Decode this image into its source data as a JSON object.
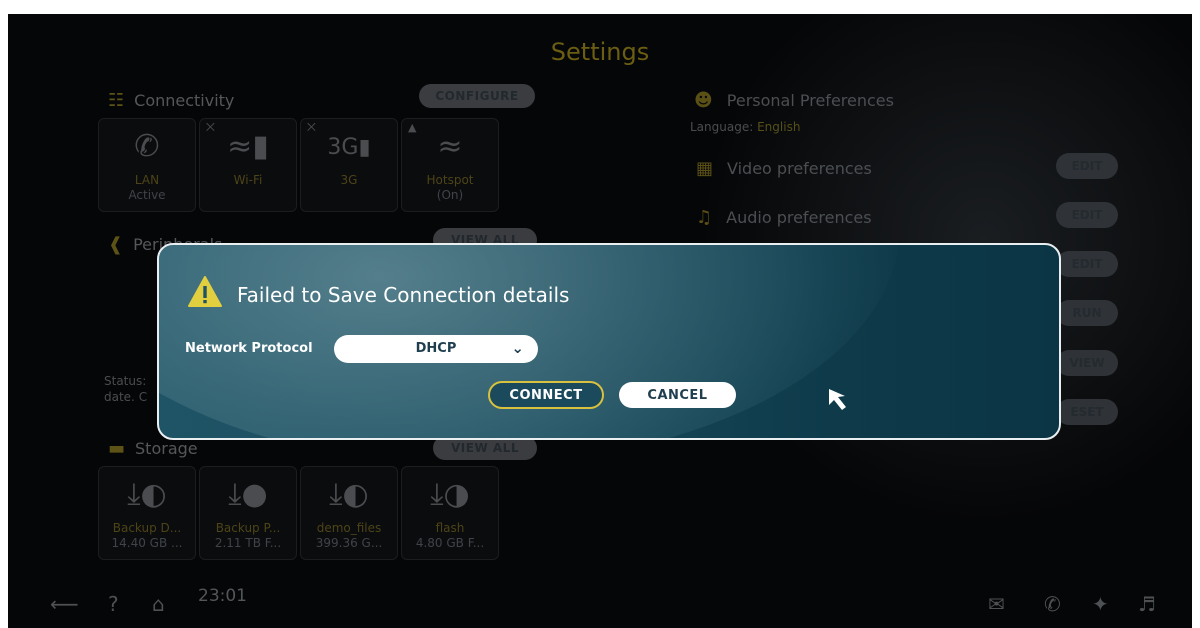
{
  "page": {
    "title": "Settings"
  },
  "connectivity": {
    "heading": "Connectivity",
    "configure_label": "CONFIGURE",
    "tiles": [
      {
        "label": "LAN",
        "sub": "Active",
        "icon": "phone-icon"
      },
      {
        "label": "Wi-Fi",
        "sub": "",
        "icon": "wifi-signal-icon"
      },
      {
        "label": "3G",
        "sub": "",
        "icon": "3g-signal-icon",
        "badge": "3G"
      },
      {
        "label": "Hotspot",
        "sub": "(On)",
        "icon": "hotspot-icon"
      }
    ]
  },
  "peripherals": {
    "heading": "Peripherals",
    "view_all_label": "VIEW ALL"
  },
  "status": {
    "line1": "Status:",
    "line2": "date. C"
  },
  "storage": {
    "heading": "Storage",
    "view_all_label": "VIEW ALL",
    "tiles": [
      {
        "label": "Backup D...",
        "sub": "14.40 GB ..."
      },
      {
        "label": "Backup P...",
        "sub": "2.11 TB F..."
      },
      {
        "label": "demo_files",
        "sub": "399.36 G..."
      },
      {
        "label": "flash",
        "sub": "4.80 GB F..."
      }
    ]
  },
  "preferences": {
    "heading": "Personal Preferences",
    "language_label": "Language:",
    "language_value": "English",
    "video": "Video preferences",
    "audio": "Audio preferences",
    "buttons": [
      "EDIT",
      "EDIT",
      "EDIT",
      "RUN",
      "VIEW",
      "ESET"
    ]
  },
  "bottom_bar": {
    "clock": "23:01"
  },
  "dialog": {
    "title": "Failed to Save Connection details",
    "protocol_label": "Network Protocol",
    "protocol_value": "DHCP",
    "connect_label": "CONNECT",
    "cancel_label": "CANCEL"
  },
  "colors": {
    "accent_yellow": "#d8c13e",
    "dialog_bg": "#1a4b5c"
  }
}
